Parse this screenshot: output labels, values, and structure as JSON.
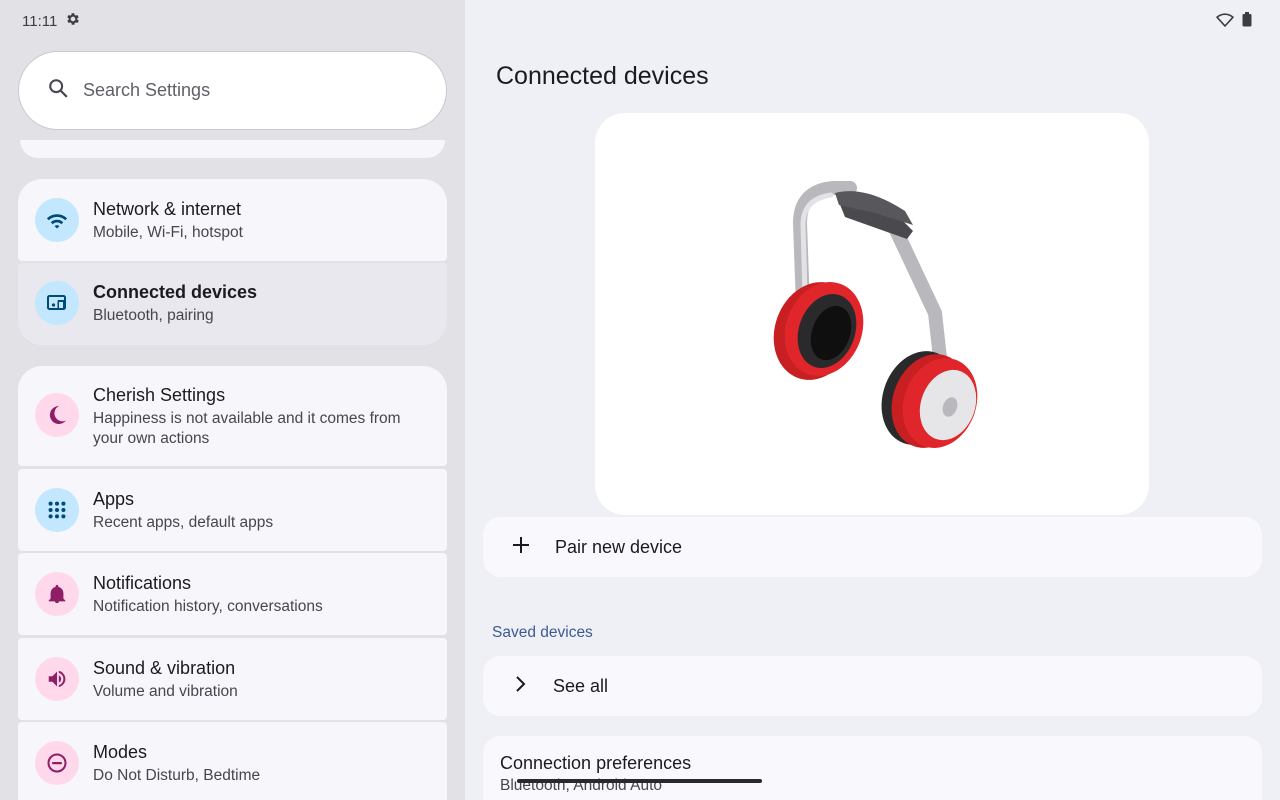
{
  "status_bar": {
    "time": "11:11"
  },
  "search": {
    "placeholder": "Search Settings"
  },
  "sidebar": {
    "items": [
      {
        "title": "Network & internet",
        "subtitle": "Mobile, Wi-Fi, hotspot",
        "icon": "wifi-icon",
        "icon_bg": "#c2e7ff",
        "icon_color": "#004a77"
      },
      {
        "title": "Connected devices",
        "subtitle": "Bluetooth, pairing",
        "icon": "devices-icon",
        "icon_bg": "#c2e7ff",
        "icon_color": "#004a77"
      },
      {
        "title": "Cherish Settings",
        "subtitle": "Happiness is not available and it comes from your own actions",
        "icon": "cherish-icon",
        "icon_bg": "#ffd8ec",
        "icon_color": "#8e1f66"
      },
      {
        "title": "Apps",
        "subtitle": "Recent apps, default apps",
        "icon": "apps-grid-icon",
        "icon_bg": "#c2e7ff",
        "icon_color": "#004a77"
      },
      {
        "title": "Notifications",
        "subtitle": "Notification history, conversations",
        "icon": "bell-icon",
        "icon_bg": "#ffd8ec",
        "icon_color": "#8e1f66"
      },
      {
        "title": "Sound & vibration",
        "subtitle": "Volume and vibration",
        "icon": "speaker-icon",
        "icon_bg": "#ffd8ec",
        "icon_color": "#8e1f66"
      },
      {
        "title": "Modes",
        "subtitle": "Do Not Disturb, Bedtime",
        "icon": "do-not-disturb-icon",
        "icon_bg": "#ffd8ec",
        "icon_color": "#8e1f66"
      }
    ]
  },
  "main": {
    "title": "Connected devices",
    "pair_new_device": "Pair new device",
    "saved_devices_header": "Saved devices",
    "see_all": "See all",
    "connection_preferences": {
      "title": "Connection preferences",
      "subtitle": "Bluetooth, Android Auto"
    }
  }
}
